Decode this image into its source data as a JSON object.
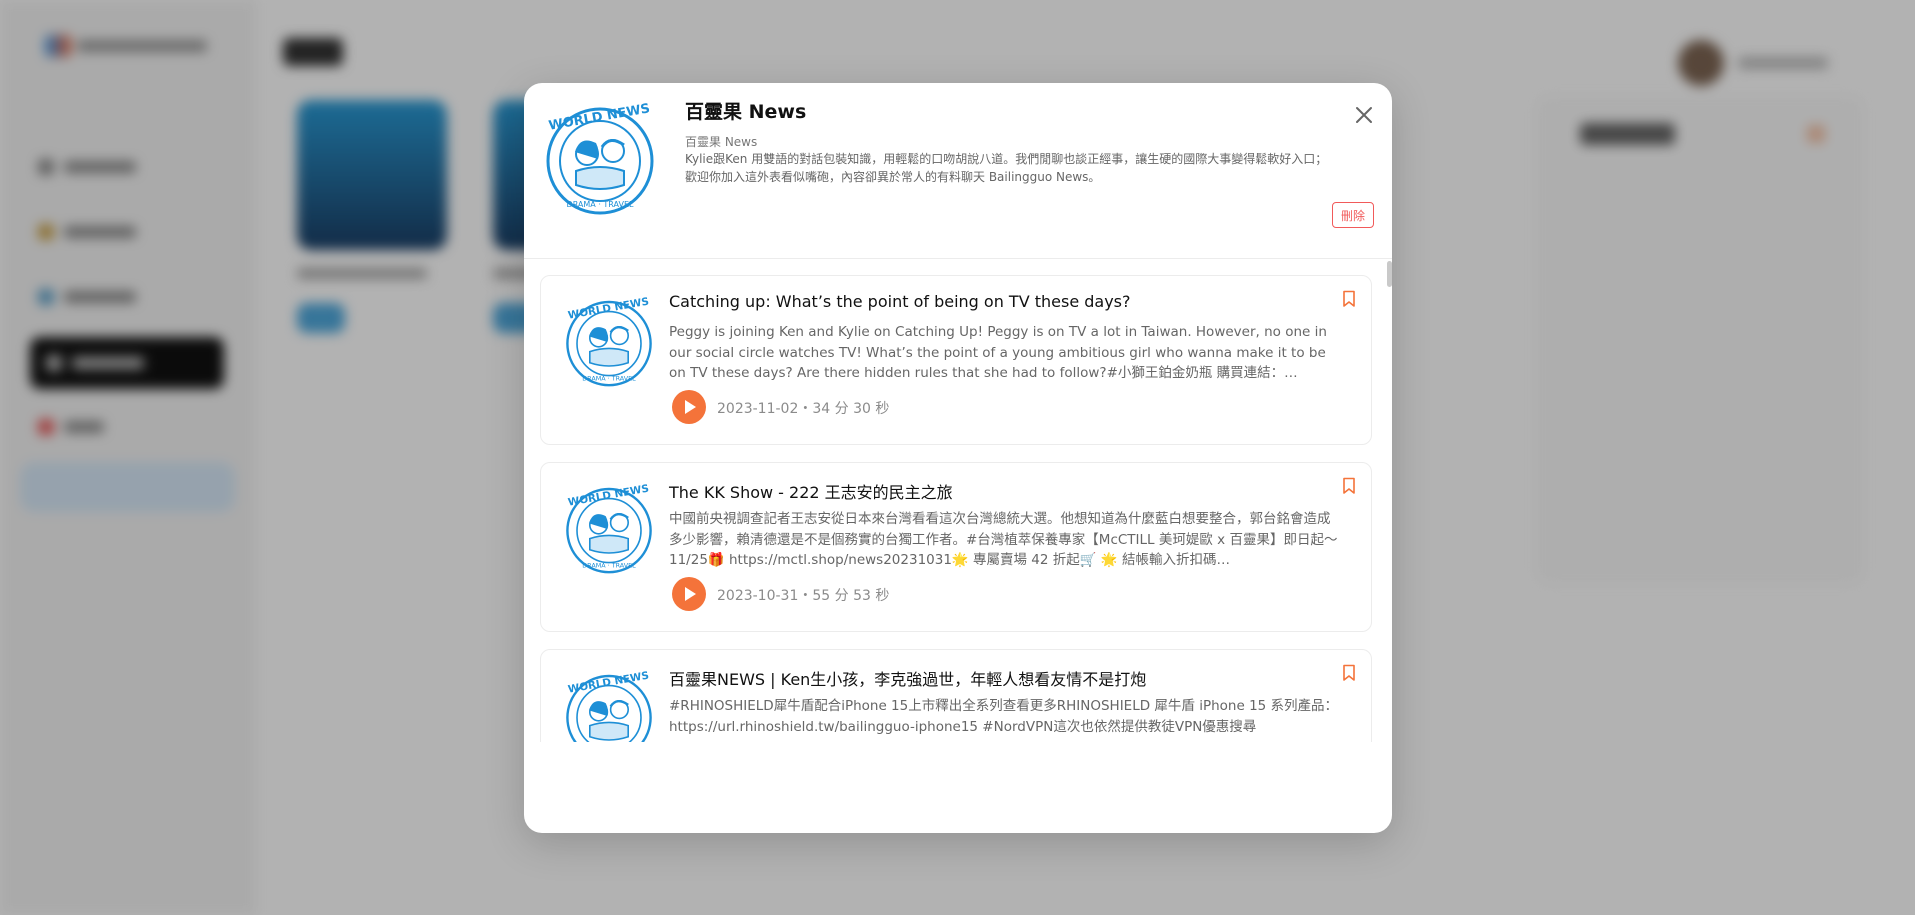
{
  "podcast": {
    "title": "百靈果 News",
    "author": "百靈果 News",
    "description": "Kylie跟Ken 用雙語的對話包裝知識，用輕鬆的口吻胡說八道。我們閒聊也談正經事，讓生硬的國際大事變得鬆軟好入口；歡迎你加入這外表看似嘴砲，內容卻異於常人的有料聊天 Bailingguo News。",
    "delete_label": "刪除",
    "artwork_alt": "WORLD NEWS",
    "artwork_arc_text": "MOVIES · DRAMA · TRAVEL · IDEAS · BOOKS"
  },
  "episodes": [
    {
      "title": "Catching up: What’s the point of being on TV these days?",
      "description": "Peggy is joining Ken and Kylie on Catching Up! Peggy is on TV a lot in Taiwan. However, no one in our social circle watches TV! What’s the point of a young ambitious girl who wanna make it to be on TV these days? Are there hidden rules that she had to follow?#小獅王鉑金奶瓶 購買連結：…",
      "meta": "2023-11-02・34 分 30 秒"
    },
    {
      "title": "The KK Show - 222 王志安的民主之旅",
      "description": "中國前央視調查記者王志安從日本來台灣看看這次台灣總統大選。他想知道為什麼藍白想要整合，郭台銘會造成多少影響，賴清德還是不是個務實的台獨工作者。#台灣植萃保養專家【McCTILL 美珂媞歐 x 百靈果】即日起～11/25🎁 https://mctl.shop/news20231031🌟 專屬賣場 42 折起🛒 🌟 結帳輸入折扣碼…",
      "meta": "2023-10-31・55 分 53 秒"
    },
    {
      "title": "百靈果NEWS | Ken生小孩，李克強過世，年輕人想看友情不是打炮",
      "description": "#RHINOSHIELD犀牛盾配合iPhone 15上市釋出全系列查看更多RHINOSHIELD 犀牛盾 iPhone 15 系列產品：https://url.rhinoshield.tw/bailingguo-iphone15 #NordVPN這次也依然提供教徒VPN優惠搜尋",
      "meta": ""
    }
  ],
  "icons": {
    "close": "close-icon",
    "play": "play-icon",
    "bookmark": "bookmark-icon"
  },
  "colors": {
    "accent": "#f4733a",
    "danger": "#f15a5a",
    "artwork_blue": "#1e8fd6"
  }
}
